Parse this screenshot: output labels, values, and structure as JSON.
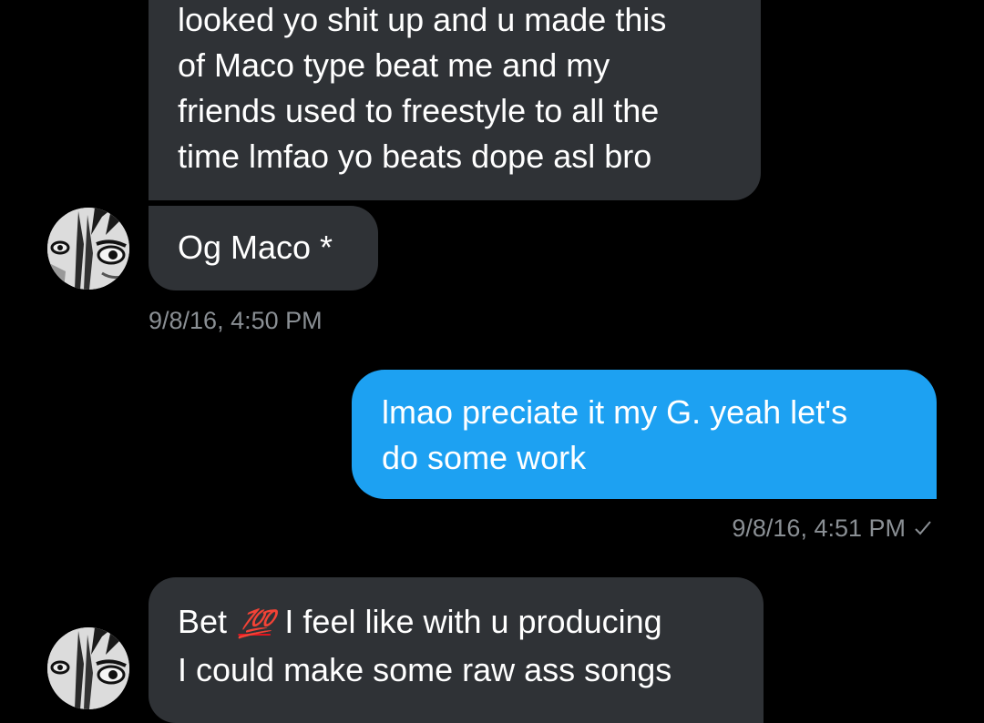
{
  "conversation": {
    "messages": [
      {
        "direction": "received",
        "lines": [
          "looked yo shit up and u made this",
          "of Maco type beat me and my",
          "friends used to freestyle to all the",
          "time lmfao yo beats dope asl bro"
        ]
      },
      {
        "direction": "received",
        "lines": [
          "Og Maco *"
        ],
        "timestamp": "9/8/16, 4:50 PM",
        "avatar": "profile-photo-icon"
      },
      {
        "direction": "sent",
        "lines": [
          "lmao preciate it my G. yeah let's",
          "do some work"
        ],
        "timestamp": "9/8/16, 4:51 PM",
        "status_icon": "checkmark-icon"
      },
      {
        "direction": "received",
        "line1_start": "Bet",
        "emoji": "💯",
        "emoji_icon": "hundred-points-emoji-icon",
        "line1_end": "I feel like with u producing",
        "line2": "I could make some raw ass songs",
        "avatar": "profile-photo-icon"
      }
    ]
  },
  "colors": {
    "background": "#000000",
    "received_bubble": "#2f3236",
    "sent_bubble": "#1da1f2",
    "timestamp_text": "#8a8f94",
    "emoji_red": "#e0141f"
  }
}
